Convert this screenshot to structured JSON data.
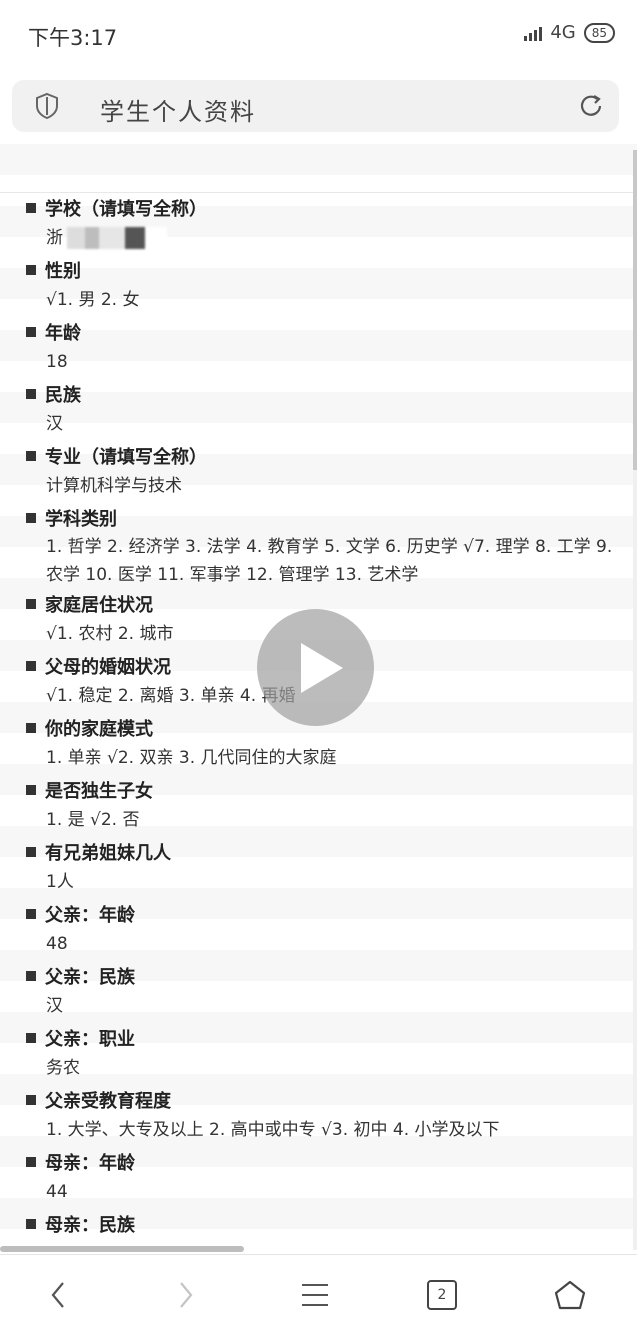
{
  "status": {
    "time": "下午3:17",
    "network": "4G",
    "battery": "85"
  },
  "browser": {
    "title": "学生个人资料",
    "tab_count": "2"
  },
  "form": {
    "items": [
      {
        "title": "学校（请填写全称）",
        "answer": "浙"
      },
      {
        "title": "性别",
        "answer": "√1. 男  2. 女"
      },
      {
        "title": "年龄",
        "answer": "18"
      },
      {
        "title": "民族",
        "answer": "汉"
      },
      {
        "title": "专业（请填写全称）",
        "answer": "计算机科学与技术"
      },
      {
        "title": "学科类别",
        "answer": "1. 哲学  2. 经济学  3. 法学  4. 教育学  5. 文学  6. 历史学  √7. 理学  8. 工学  9. 农学  10. 医学  11. 军事学  12. 管理学  13. 艺术学"
      },
      {
        "title": "家庭居住状况",
        "answer": "√1. 农村  2. 城市"
      },
      {
        "title": "父母的婚姻状况",
        "answer": "√1. 稳定  2. 离婚  3. 单亲  4. 再婚"
      },
      {
        "title": "你的家庭模式",
        "answer": "1. 单亲  √2. 双亲  3. 几代同住的大家庭"
      },
      {
        "title": "是否独生子女",
        "answer": "1. 是  √2. 否"
      },
      {
        "title": "有兄弟姐妹几人",
        "answer": "1人"
      },
      {
        "title": "父亲：年龄",
        "answer": "48"
      },
      {
        "title": "父亲：民族",
        "answer": "汉"
      },
      {
        "title": "父亲：职业",
        "answer": "务农"
      },
      {
        "title": "父亲受教育程度",
        "answer": "1. 大学、大专及以上  2. 高中或中专  √3. 初中  4. 小学及以下"
      },
      {
        "title": "母亲：年龄",
        "answer": "44"
      },
      {
        "title": "母亲：民族",
        "answer": ""
      }
    ]
  }
}
